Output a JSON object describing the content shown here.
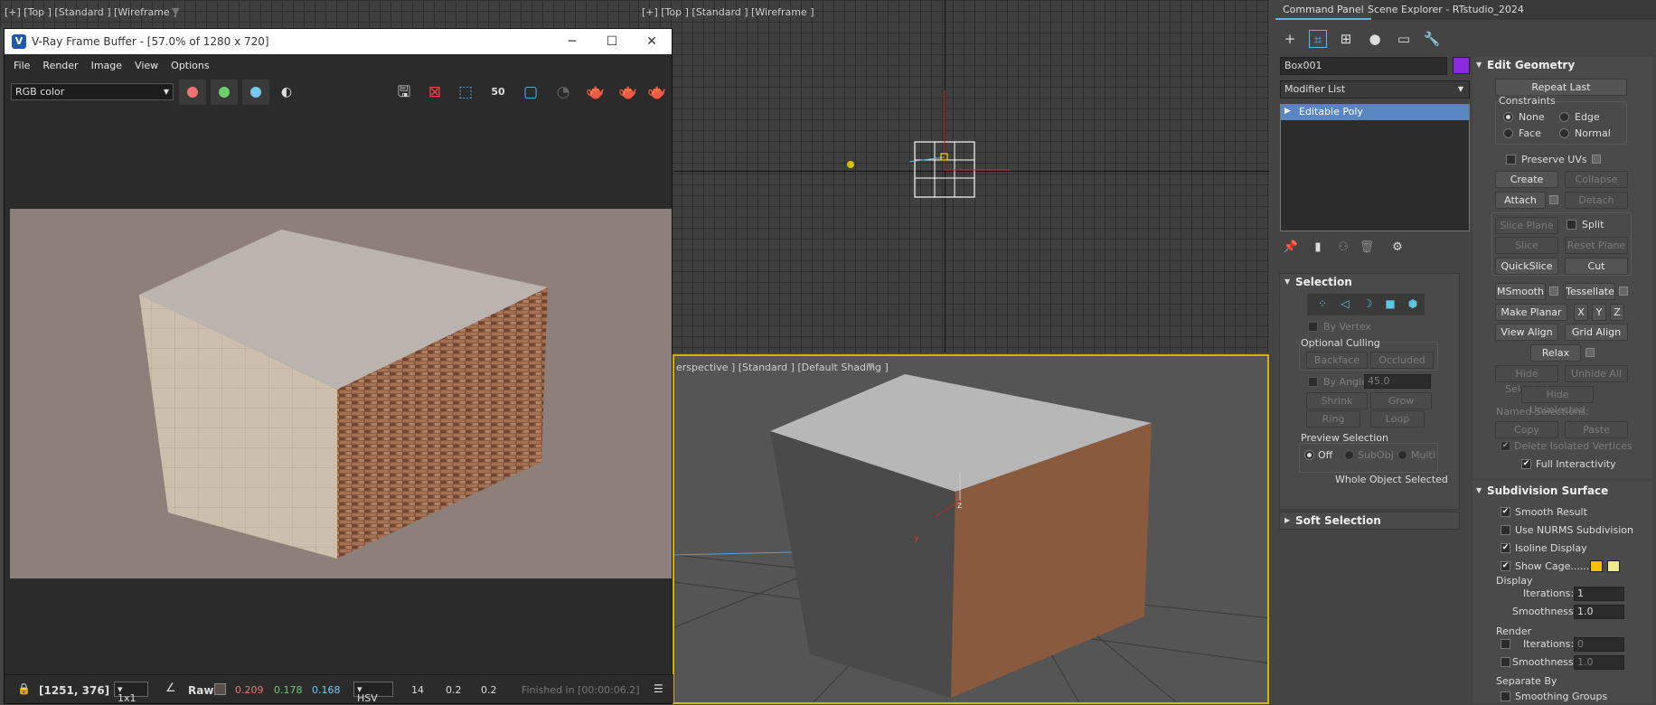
{
  "viewports": {
    "top_left_label": "[+] [Top ] [Standard ] [Wireframe ]",
    "top_right_label": "[+] [Top ] [Standard ] [Wireframe ]",
    "bottom_label": "erspective ] [Standard ] [Default Shading ]",
    "axis_z": "z",
    "axis_y": "y"
  },
  "vfb": {
    "title": "V-Ray Frame Buffer - [57.0% of 1280 x 720]",
    "menu": [
      "File",
      "Render",
      "Image",
      "View",
      "Options"
    ],
    "channel": "RGB color",
    "zoom_label": "50",
    "status": {
      "coords": "[1251, 376]",
      "ratio": "1x1",
      "raw": "Raw",
      "r": "0.209",
      "g": "0.178",
      "b": "0.168",
      "mode": "HSV",
      "h": "14",
      "s": "0.2",
      "v": "0.2",
      "finished": "Finished in [00:00:06.2]"
    },
    "colors": {
      "red": "#f07272",
      "green": "#6ccf6c",
      "blue": "#72c8f0"
    }
  },
  "panel": {
    "tabs": [
      "Command Panel",
      "Scene Explorer - RTstudio_2024"
    ],
    "object_name": "Box001",
    "object_color": "#8a2be2",
    "modifier_list": "Modifier List",
    "stack_item": "Editable Poly",
    "selection": {
      "header": "Selection",
      "by_vertex": "By Vertex",
      "optional_culling": "Optional Culling",
      "backface": "Backface",
      "occluded": "Occluded",
      "by_angle": "By Angle:",
      "angle_value": "45.0",
      "shrink": "Shrink",
      "grow": "Grow",
      "ring": "Ring",
      "loop": "Loop",
      "preview_selection": "Preview Selection",
      "off": "Off",
      "subobj": "SubObj",
      "multi": "Multi",
      "status": "Whole Object Selected"
    },
    "soft_selection": "Soft Selection",
    "edit_geometry": {
      "header": "Edit Geometry",
      "repeat_last": "Repeat Last",
      "constraints": "Constraints",
      "none": "None",
      "edge": "Edge",
      "face": "Face",
      "normal": "Normal",
      "preserve_uvs": "Preserve UVs",
      "create": "Create",
      "collapse": "Collapse",
      "attach": "Attach",
      "detach": "Detach",
      "slice_plane": "Slice Plane",
      "split": "Split",
      "slice": "Slice",
      "reset_plane": "Reset Plane",
      "quickslice": "QuickSlice",
      "cut": "Cut",
      "msmooth": "MSmooth",
      "tessellate": "Tessellate",
      "make_planar": "Make Planar",
      "x": "X",
      "y": "Y",
      "z": "Z",
      "view_align": "View Align",
      "grid_align": "Grid Align",
      "relax": "Relax",
      "hide_selected": "Hide Selected",
      "unhide_all": "Unhide All",
      "hide_unselected": "Hide Unselected",
      "named_selections": "Named Selections:",
      "copy": "Copy",
      "paste": "Paste",
      "delete_isolated": "Delete Isolated Vertices",
      "full_interactivity": "Full Interactivity"
    },
    "subdivision": {
      "header": "Subdivision Surface",
      "smooth_result": "Smooth Result",
      "use_nurms": "Use NURMS Subdivision",
      "isoline": "Isoline Display",
      "show_cage": "Show Cage......",
      "display": "Display",
      "iterations": "Iterations:",
      "iter_value": "1",
      "smoothness": "Smoothness:",
      "smooth_value": "1.0",
      "render": "Render",
      "r_iter_value": "0",
      "r_smooth_value": "1.0",
      "separate_by": "Separate By",
      "smoothing_groups": "Smoothing Groups"
    }
  }
}
